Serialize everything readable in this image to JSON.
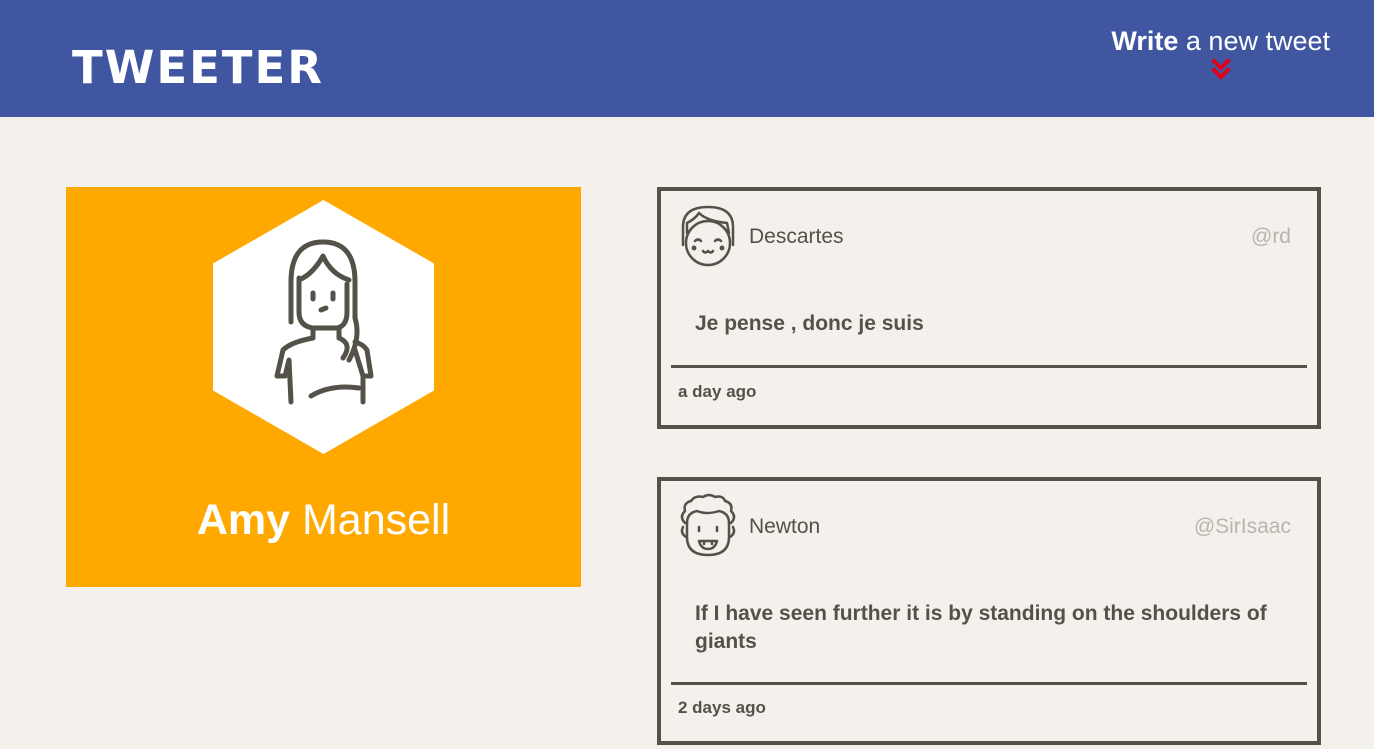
{
  "header": {
    "brand": "TWEETER",
    "compose_strong": "Write",
    "compose_light": "a new tweet",
    "compose_icon": "double-chevron-down-icon",
    "accent_color": "#4056a1",
    "icon_color": "#e0001a"
  },
  "profile": {
    "first_name": "Amy",
    "last_name": "Mansell",
    "avatar_icon": "woman-avatar-icon",
    "card_color": "#ffa800"
  },
  "tweets": [
    {
      "avatar_icon": "girl-avatar-icon",
      "name": "Descartes",
      "handle": "@rd",
      "text": "Je pense , donc je suis",
      "time": "a day ago"
    },
    {
      "avatar_icon": "curly-hair-avatar-icon",
      "name": "Newton",
      "handle": "@SirIsaac",
      "text": "If I have seen further it is by standing on the shoulders of giants",
      "time": "2 days ago"
    }
  ]
}
